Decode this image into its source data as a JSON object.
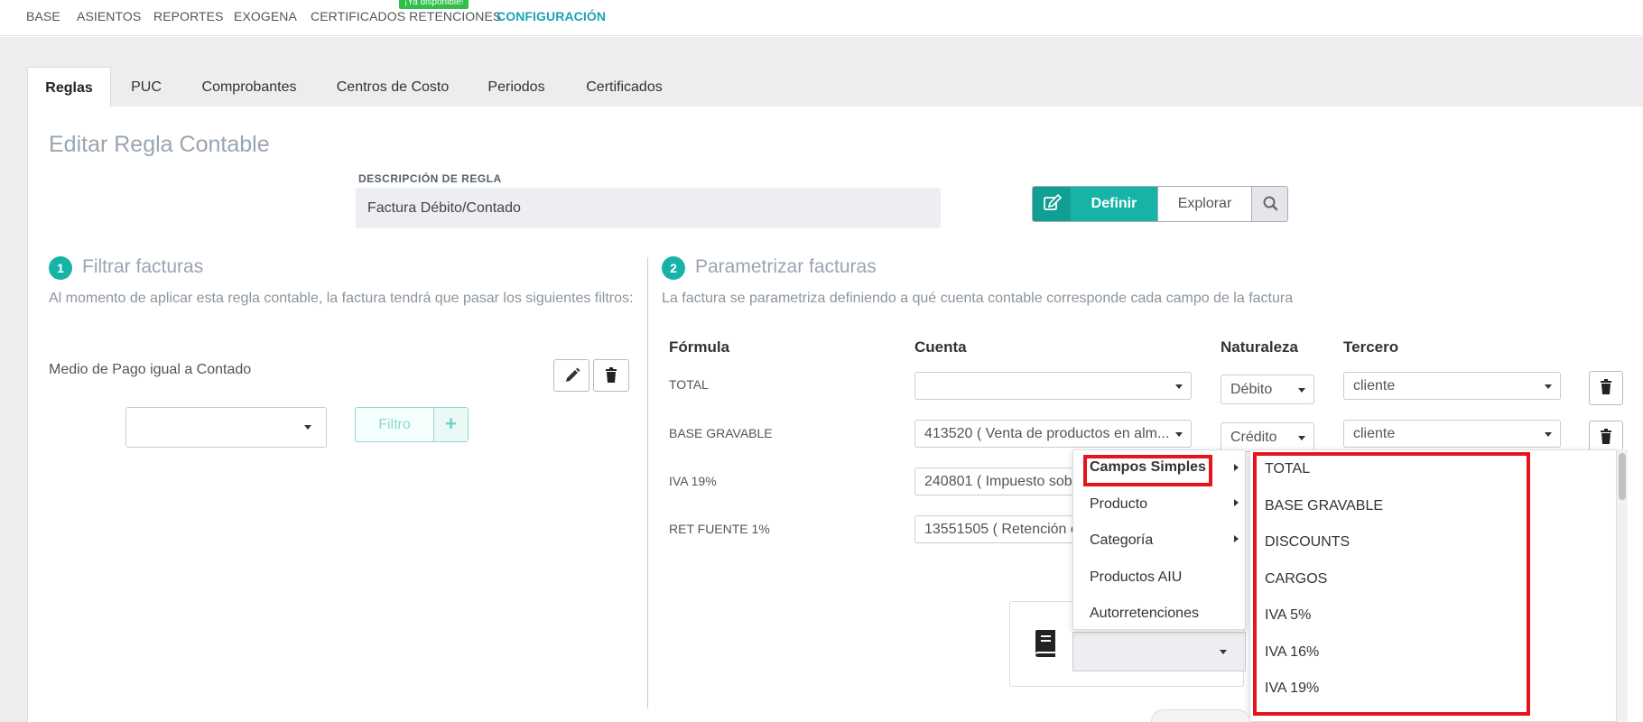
{
  "nav": {
    "items": [
      "BASE",
      "ASIENTOS",
      "REPORTES",
      "EXOGENA",
      "CERTIFICADOS RETENCIONES",
      "CONFIGURACIÓN"
    ],
    "badge": "¡Ya disponible!"
  },
  "tabs": [
    "Reglas",
    "PUC",
    "Comprobantes",
    "Centros de Costo",
    "Periodos",
    "Certificados"
  ],
  "page_title": "Editar Regla Contable",
  "description": {
    "label": "DESCRIPCIÓN DE REGLA",
    "value": "Factura Débito/Contado"
  },
  "mode": {
    "define_label": "Definir",
    "explore_label": "Explorar"
  },
  "step1": {
    "number": "1",
    "title": "Filtrar facturas",
    "desc": "Al momento de aplicar esta regla contable, la factura tendrá que pasar los siguientes filtros:",
    "filter_text": "Medio de Pago igual a Contado",
    "filter_select_value": "",
    "filter_button": "Filtro"
  },
  "step2": {
    "number": "2",
    "title": "Parametrizar facturas",
    "desc": "La factura se parametriza definiendo a qué cuenta contable corresponde cada campo de la factura",
    "headers": {
      "formula": "Fórmula",
      "cuenta": "Cuenta",
      "naturaleza": "Naturaleza",
      "tercero": "Tercero"
    },
    "rows": [
      {
        "formula": "TOTAL",
        "cuenta": "",
        "naturaleza": "Débito",
        "tercero": "cliente"
      },
      {
        "formula": "BASE GRAVABLE",
        "cuenta": "413520 ( Venta de productos en alm...",
        "naturaleza": "Crédito",
        "tercero": "cliente"
      },
      {
        "formula": "IVA 19%",
        "cuenta": "240801 ( Impuesto sob"
      },
      {
        "formula": "RET FUENTE 1%",
        "cuenta": "13551505 ( Retención e"
      }
    ]
  },
  "menu_categories": [
    "Campos Simples",
    "Producto",
    "Categoría",
    "Productos AIU",
    "Autorretenciones"
  ],
  "menu_options": [
    "TOTAL",
    "BASE GRAVABLE",
    "DISCOUNTS",
    "CARGOS",
    "IVA 5%",
    "IVA 16%",
    "IVA 19%"
  ],
  "colors": {
    "accent": "#17b3a6",
    "nav_active": "#1aa3b8",
    "highlight": "#e8141c"
  }
}
